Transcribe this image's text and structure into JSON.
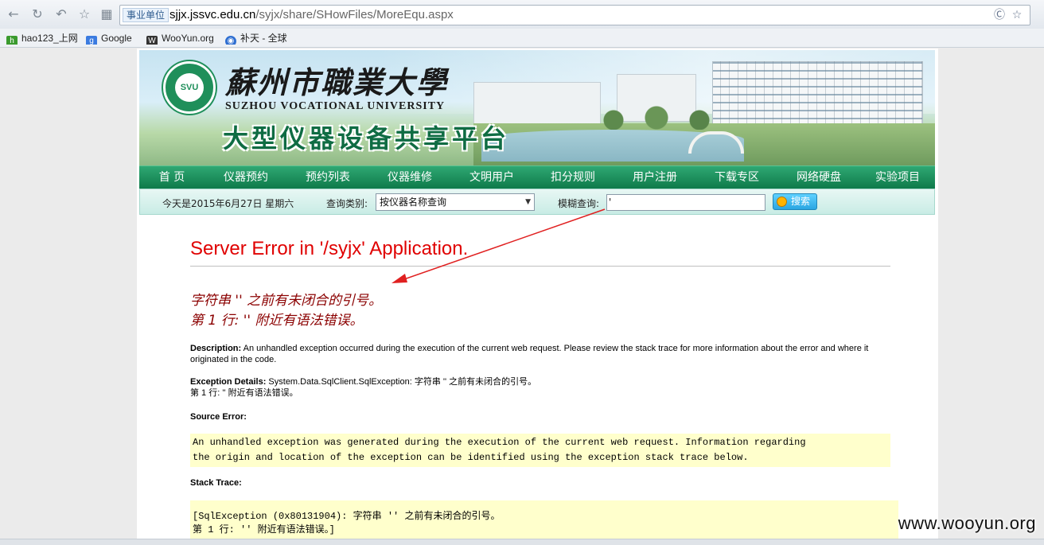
{
  "browser": {
    "cert_badge": "事业单位",
    "url_host": "sjjx.jssvc.edu.cn",
    "url_path": "/syjx/share/SHowFiles/MoreEqu.aspx",
    "bookmarks": [
      {
        "label": "hao123_上网",
        "icon": "hao123-icon",
        "color": "#3a9a2e"
      },
      {
        "label": "Google",
        "icon": "google-icon",
        "color": "#3b7be0"
      },
      {
        "label": "WooYun.org",
        "icon": "wooyun-icon",
        "color": "#333333"
      },
      {
        "label": "补天 - 全球",
        "icon": "butian-icon",
        "color": "#2f6fd1"
      }
    ]
  },
  "banner": {
    "school_cn": "蘇州市職業大學",
    "school_en": "SUZHOU VOCATIONAL UNIVERSITY",
    "logo_text": "SVU",
    "platform_title": "大型仪器设备共享平台"
  },
  "nav": {
    "items": [
      "首 页",
      "仪器预约",
      "预约列表",
      "仪器维修",
      "文明用户",
      "扣分规则",
      "用户注册",
      "下载专区",
      "网络硬盘",
      "实验项目"
    ]
  },
  "search": {
    "date_text": "今天是2015年6月27日 星期六",
    "category_label": "查询类别:",
    "category_value": "按仪器名称查询",
    "keyword_label": "模糊查询:",
    "keyword_value": "'",
    "button_label": "搜索"
  },
  "error": {
    "title": "Server Error in '/syjx' Application.",
    "message_line1": "字符串 '' 之前有未闭合的引号。",
    "message_line2": "第 1 行: '' 附近有语法错误。",
    "description_label": "Description:",
    "description_text": "An unhandled exception occurred during the execution of the current web request. Please review the stack trace for more information about the error and where it originated in the code.",
    "exception_label": "Exception Details:",
    "exception_text": "System.Data.SqlClient.SqlException: 字符串 '' 之前有未闭合的引号。",
    "exception_line2": "第 1 行: '' 附近有语法错误。",
    "source_label": "Source Error:",
    "source_line1": "An unhandled exception was generated during the execution of the current web request. Information regarding",
    "source_line2": "the origin and location of the exception can be identified using the exception stack trace below.",
    "stack_label": "Stack Trace:",
    "stack_line1": "[SqlException (0x80131904): 字符串 '' 之前有未闭合的引号。",
    "stack_line2": "第 1 行: '' 附近有语法错误。]"
  },
  "watermark": "www.wooyun.org",
  "colors": {
    "error_red": "#e00000",
    "error_dark_red": "#8b0000",
    "nav_green": "#0e7a4a",
    "code_bg": "#ffffcc",
    "annotation_arrow": "#e02020"
  }
}
